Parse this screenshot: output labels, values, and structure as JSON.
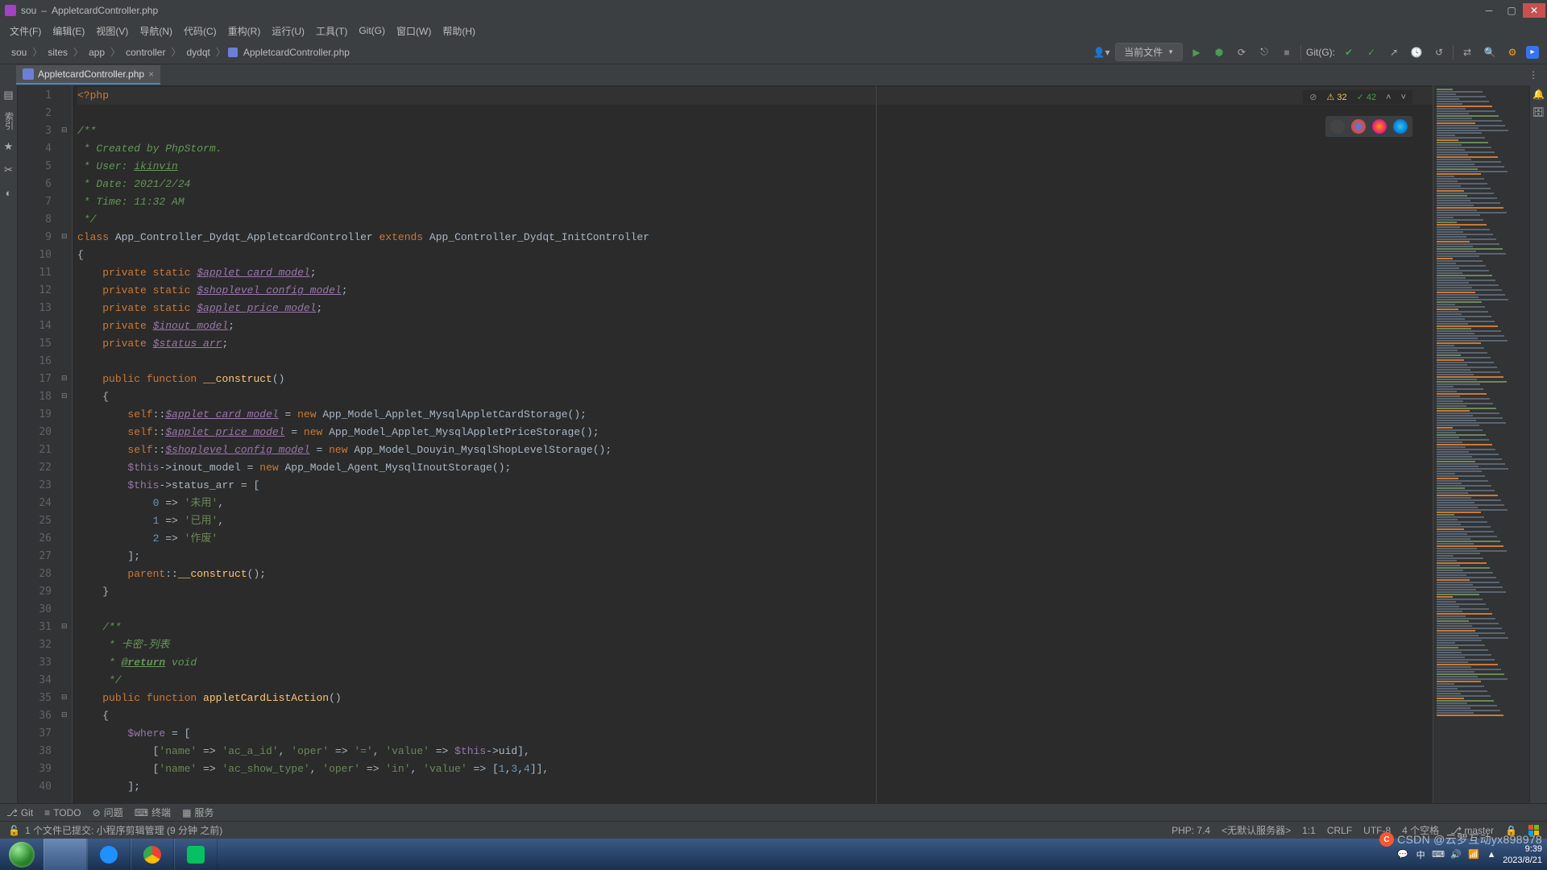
{
  "title": {
    "project": "sou",
    "dash": "–",
    "file": "AppletcardController.php"
  },
  "menu": [
    "文件(F)",
    "编辑(E)",
    "视图(V)",
    "导航(N)",
    "代码(C)",
    "重构(R)",
    "运行(U)",
    "工具(T)",
    "Git(G)",
    "窗口(W)",
    "帮助(H)"
  ],
  "breadcrumbs": [
    "sou",
    "sites",
    "app",
    "controller",
    "dydqt",
    "AppletcardController.php"
  ],
  "scope_label": "当前文件",
  "git_label": "Git(G):",
  "tab": {
    "name": "AppletcardController.php"
  },
  "inspector": {
    "warnings": "32",
    "typos": "42",
    "warn_icon": "⚠",
    "check_icon": "✓"
  },
  "code": {
    "1": {
      "t": "<?php",
      "hl": true
    },
    "2": {
      "t": ""
    },
    "3": {
      "t": "/**",
      "cls": "doc"
    },
    "4": {
      "t": " * Created by PhpStorm.",
      "cls": "doc"
    },
    "5": {
      "pre": " * User: ",
      "u": "ikinvin"
    },
    "6": {
      "t": " * Date: 2021/2/24",
      "cls": "doc"
    },
    "7": {
      "t": " * Time: 11:32 AM",
      "cls": "doc"
    },
    "8": {
      "t": " */",
      "cls": "doc"
    },
    "9": {
      "php": true
    },
    "10": {
      "t": "{"
    },
    "11": {
      "priv_static": "$applet_card_model"
    },
    "12": {
      "priv_static": "$shoplevel_config_model"
    },
    "13": {
      "priv_static": "$applet_price_model"
    },
    "14": {
      "priv": "$inout_model"
    },
    "15": {
      "priv": "$status_arr"
    },
    "16": {
      "t": ""
    },
    "17": {
      "func": "__construct",
      "params": "()"
    },
    "18": {
      "t": "    {"
    },
    "19": {
      "self": "$applet_card_model",
      "new_cls": "App_Model_Applet_MysqlAppletCardStorage"
    },
    "20": {
      "self": "$applet_price_model",
      "new_cls": "App_Model_Applet_MysqlAppletPriceStorage"
    },
    "21": {
      "self": "$shoplevel_config_model",
      "new_cls": "App_Model_Douyin_MysqlShopLevelStorage"
    },
    "22": {
      "this_assign": "inout_model",
      "new_cls": "App_Model_Agent_MysqlInoutStorage"
    },
    "23": {
      "this_arr": "status_arr"
    },
    "24": {
      "arr_key": "0",
      "arr_val": "'未用'",
      "comma": ","
    },
    "25": {
      "arr_key": "1",
      "arr_val": "'已用'",
      "comma": ","
    },
    "26": {
      "arr_key": "2",
      "arr_val": "'作废'",
      "comma": ""
    },
    "27": {
      "t": "        ];"
    },
    "28": {
      "parent": true
    },
    "29": {
      "t": "    }"
    },
    "30": {
      "t": ""
    },
    "31": {
      "t": "    /**",
      "cls": "doc"
    },
    "32": {
      "t": "     * 卡密-列表",
      "cls": "doc"
    },
    "33": {
      "doctag": "@return",
      "docrest": " void"
    },
    "34": {
      "t": "     */",
      "cls": "doc"
    },
    "35": {
      "func": "appletCardListAction",
      "params": "()"
    },
    "36": {
      "t": "    {"
    },
    "37": {
      "where": true
    },
    "38": {
      "where_row": true,
      "name": "'ac_a_id'",
      "oper": "'='",
      "value_is_var": true,
      "value": "$this->uid",
      "trail": ","
    },
    "39": {
      "where_row": true,
      "name": "'ac_show_type'",
      "oper": "'in'",
      "value_is_var": false,
      "value": "[1,3,4]",
      "trail": ","
    },
    "40": {
      "t": "        ];"
    }
  },
  "line_count": 40,
  "bottom_tools": {
    "git": "Git",
    "todo": "TODO",
    "problems": "问题",
    "terminal": "终端",
    "services": "服务"
  },
  "vcs_status": "1 个文件已提交: 小程序剪辑管理 (9 分钟 之前)",
  "status_right": {
    "php": "PHP: 7.4",
    "server": "<无默认服务器>",
    "pos": "1:1",
    "eol": "CRLF",
    "enc": "UTF-8",
    "indent": "4 个空格",
    "branch": "master"
  },
  "watermark": {
    "text": "CSDN @云罗互动yx898978"
  },
  "clock": {
    "time": "9:39",
    "date": "2023/8/21"
  },
  "systray": [
    "💬",
    "中",
    "⌨",
    "🔊",
    "📶",
    "▲"
  ],
  "chart_data": null
}
